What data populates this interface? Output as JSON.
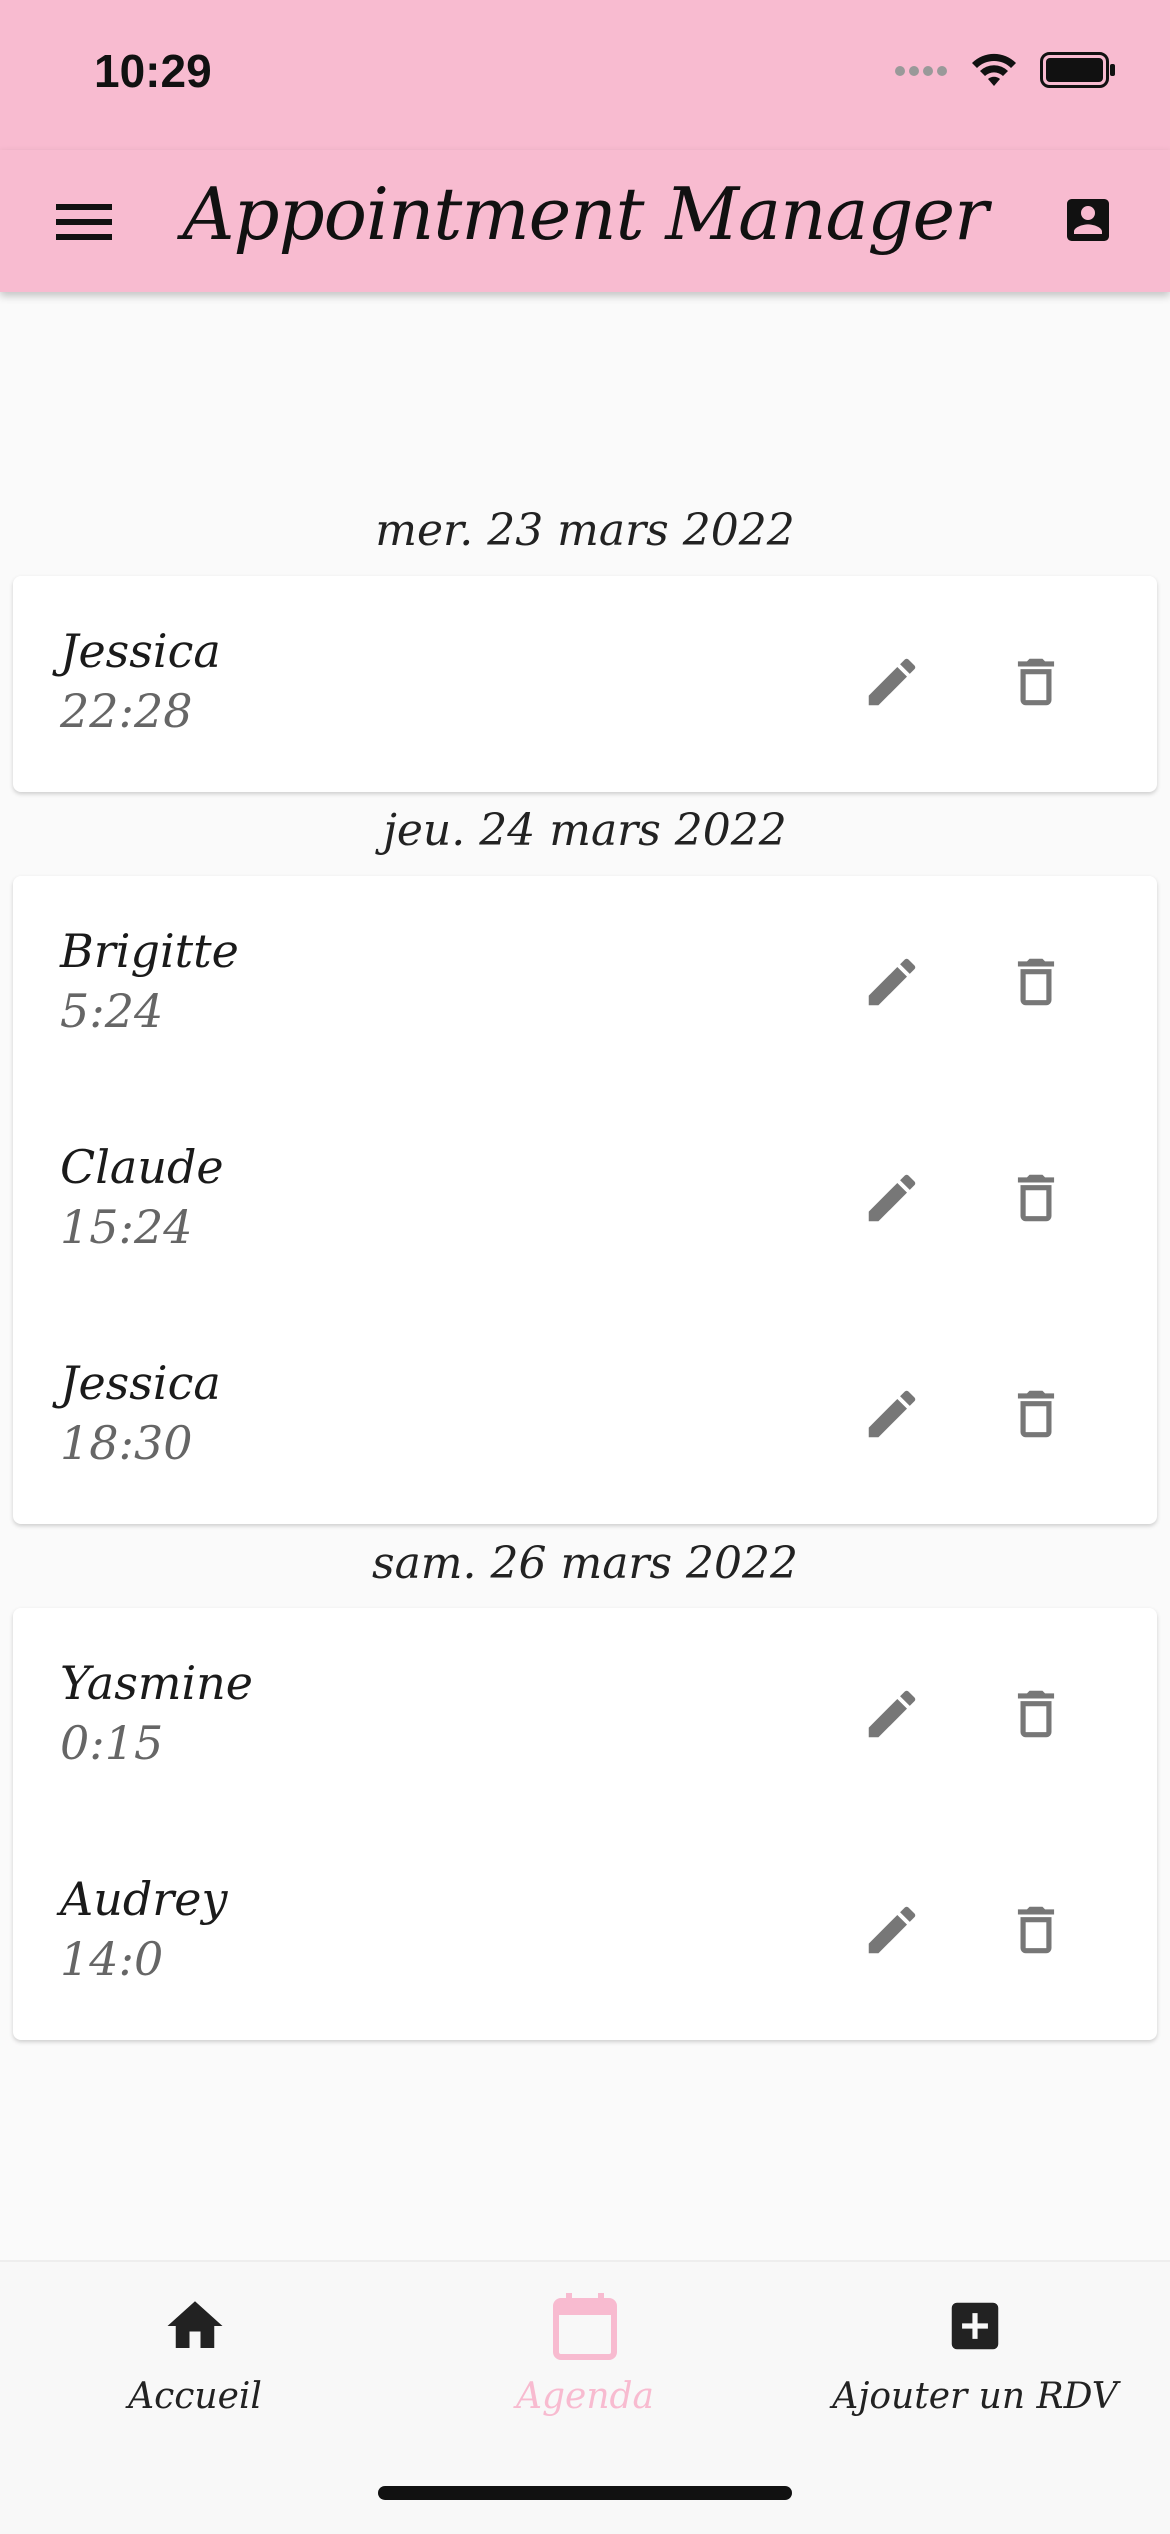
{
  "status_bar": {
    "time": "10:29"
  },
  "app_bar": {
    "title": "Appointment Manager"
  },
  "groups": [
    {
      "date": "mer. 23 mars 2022",
      "items": [
        {
          "name": "Jessica",
          "time": "22:28"
        }
      ]
    },
    {
      "date": "jeu. 24 mars 2022",
      "items": [
        {
          "name": "Brigitte",
          "time": "5:24"
        },
        {
          "name": "Claude",
          "time": "15:24"
        },
        {
          "name": "Jessica",
          "time": "18:30"
        }
      ]
    },
    {
      "date": "sam. 26 mars 2022",
      "items": [
        {
          "name": "Yasmine",
          "time": "0:15"
        },
        {
          "name": "Audrey",
          "time": "14:0"
        }
      ]
    }
  ],
  "bottom_nav": {
    "items": [
      {
        "label": "Accueil",
        "icon": "home-icon"
      },
      {
        "label": "Agenda",
        "icon": "calendar-icon",
        "active": true
      },
      {
        "label": "Ajouter un RDV",
        "icon": "add-box-icon"
      }
    ]
  },
  "colors": {
    "accent": "#f8bbd0",
    "icon_gray": "#777777"
  }
}
